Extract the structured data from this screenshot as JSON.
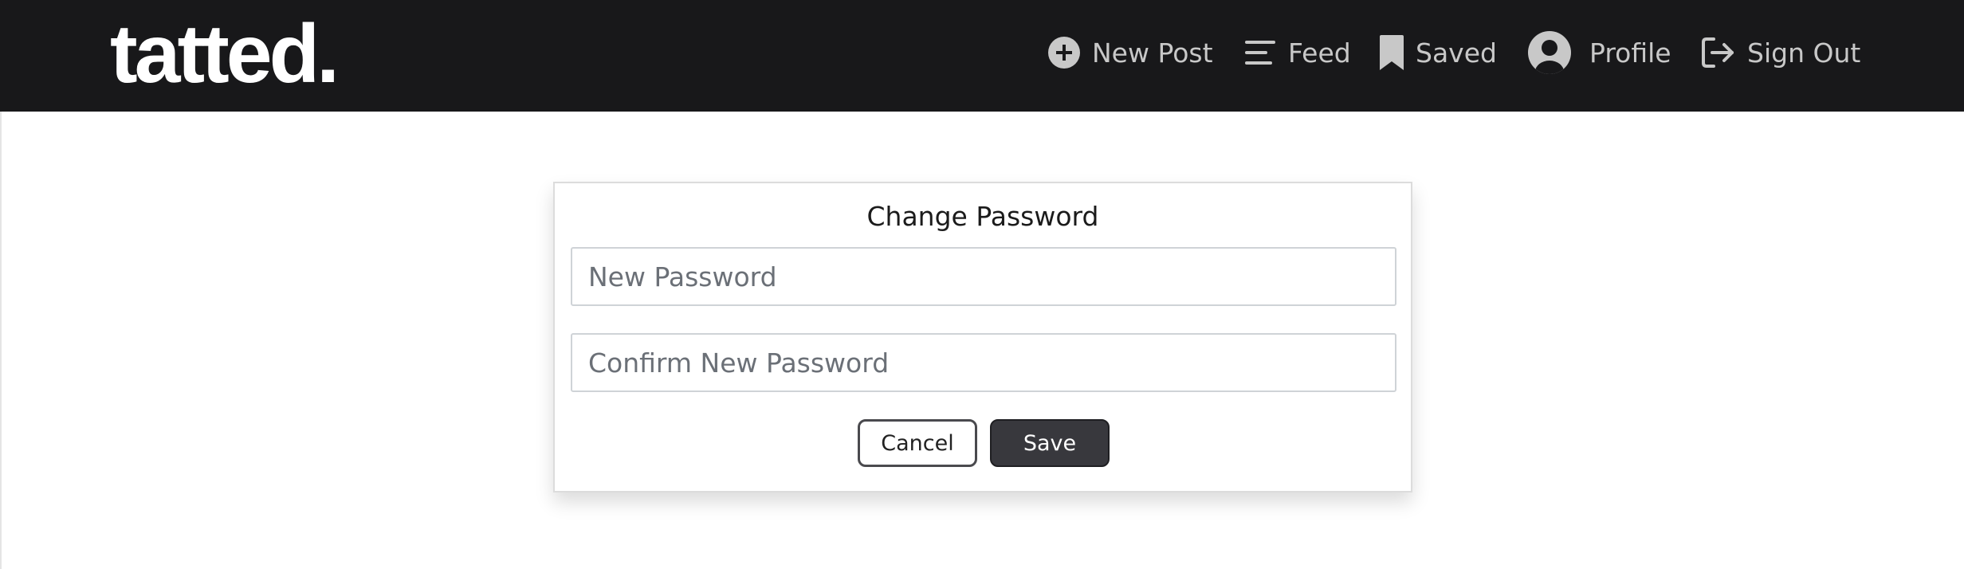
{
  "header": {
    "logo": "tatted.",
    "nav": [
      {
        "label": "New Post",
        "icon": "plus-circle-icon"
      },
      {
        "label": "Feed",
        "icon": "feed-lines-icon"
      },
      {
        "label": "Saved",
        "icon": "bookmark-icon"
      },
      {
        "label": "Profile",
        "icon": "user-avatar-icon"
      },
      {
        "label": "Sign Out",
        "icon": "sign-out-icon"
      }
    ]
  },
  "form": {
    "title": "Change Password",
    "new_password_placeholder": "New Password",
    "confirm_password_placeholder": "Confirm New Password",
    "new_password_value": "",
    "confirm_password_value": "",
    "cancel_label": "Cancel",
    "save_label": "Save"
  },
  "colors": {
    "navbar_bg": "#18181a",
    "nav_text": "#c8c8c8",
    "save_bg": "#38383d"
  }
}
